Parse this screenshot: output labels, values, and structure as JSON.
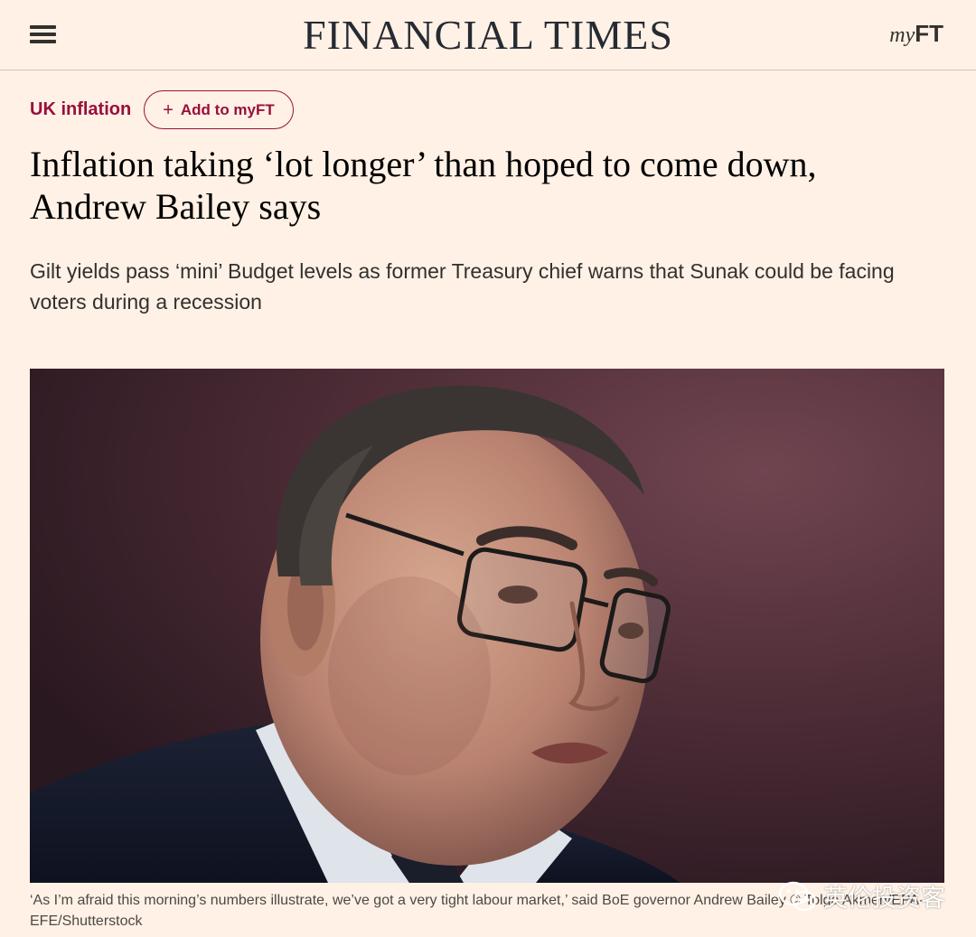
{
  "header": {
    "masthead": "FINANCIAL TIMES",
    "myft_prefix": "my",
    "myft_suffix": "FT",
    "menu_icon": "hamburger-menu-icon"
  },
  "article": {
    "topic": "UK inflation",
    "add_to_myft": "Add to myFT",
    "headline": "Inflation taking ‘lot longer’ than hoped to come down, Andrew Bailey says",
    "standfirst": "Gilt yields pass ‘mini’ Budget levels as former Treasury chief warns that Sunak could be facing voters during a recession",
    "caption": "‘As I’m afraid this morning’s numbers illustrate, we’ve got a very tight labour market,’ said BoE governor Andrew Bailey © Tolga Akmen/EPA-EFE/Shutterstock"
  },
  "watermark": {
    "text": "英伦投资客",
    "icon": "wechat-icon"
  },
  "colors": {
    "background": "#fff1e5",
    "accent": "#990f3d",
    "text": "#33302e"
  }
}
